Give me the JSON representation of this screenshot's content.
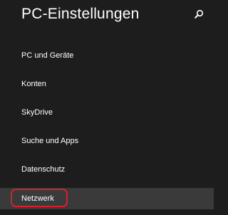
{
  "header": {
    "title": "PC-Einstellungen",
    "search_icon": "search-icon"
  },
  "nav": {
    "items": [
      {
        "label": "PC und Geräte"
      },
      {
        "label": "Konten"
      },
      {
        "label": "SkyDrive"
      },
      {
        "label": "Suche und Apps"
      },
      {
        "label": "Datenschutz"
      },
      {
        "label": "Netzwerk",
        "selected": true
      }
    ]
  },
  "colors": {
    "background": "#1d1d1d",
    "selected_background": "#3a3a3a",
    "text": "#ffffff",
    "highlight_annotation": "#d4202f"
  }
}
